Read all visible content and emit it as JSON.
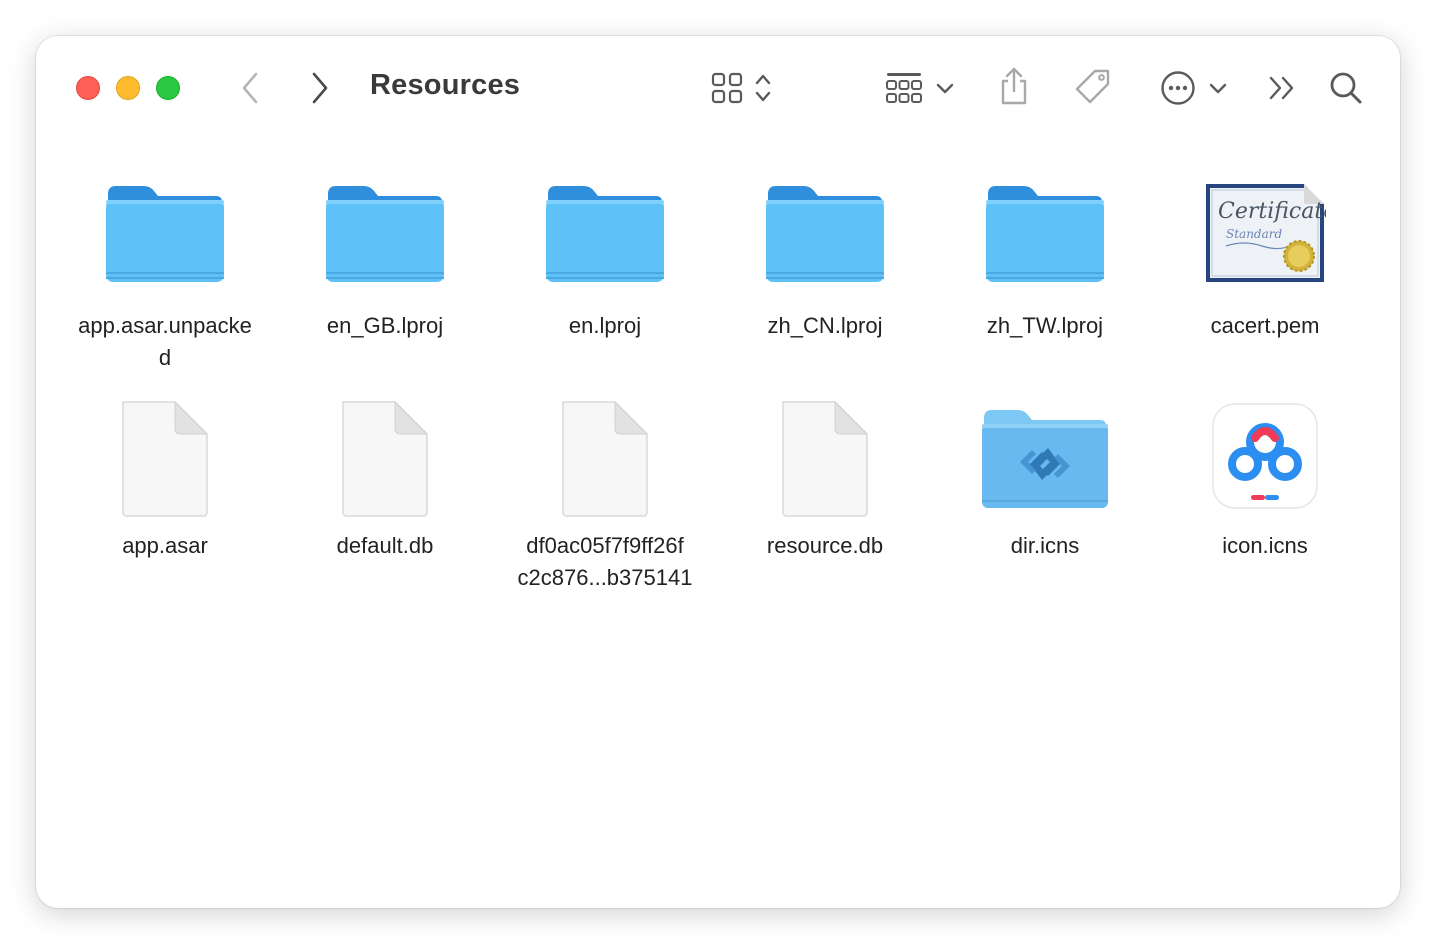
{
  "window": {
    "title": "Resources"
  },
  "toolbar": {
    "icons": [
      "back-chevron-icon",
      "forward-chevron-icon",
      "icon-view-icon",
      "sort-updown-icon",
      "group-grid-icon",
      "chevron-down-icon",
      "share-icon",
      "tag-icon",
      "more-circle-icon",
      "chevron-down-icon",
      "overflow-icon",
      "search-icon"
    ]
  },
  "files": [
    {
      "name": "app.asar.unpacke\nd",
      "label_line1": "app.asar.unpacke",
      "label_line2": "d",
      "kind": "folder"
    },
    {
      "name": "en_GB.lproj",
      "kind": "folder"
    },
    {
      "name": "en.lproj",
      "kind": "folder"
    },
    {
      "name": "zh_CN.lproj",
      "kind": "folder"
    },
    {
      "name": "zh_TW.lproj",
      "kind": "folder"
    },
    {
      "name": "cacert.pem",
      "kind": "certificate",
      "cert_text_1": "Certificate",
      "cert_text_2": "Standard"
    },
    {
      "name": "app.asar",
      "kind": "document"
    },
    {
      "name": "default.db",
      "kind": "document"
    },
    {
      "name": "df0ac05f7f9ff26f",
      "label_line1": "df0ac05f7f9ff26f",
      "label_line2": "c2c876...b375141",
      "kind": "document"
    },
    {
      "name": "resource.db",
      "kind": "document"
    },
    {
      "name": "dir.icns",
      "kind": "app-folder"
    },
    {
      "name": "icon.icns",
      "kind": "app-icon"
    }
  ],
  "colors": {
    "folder_top": "#2f8fdd",
    "folder_body": "#5ec1f8",
    "close": "#fe5f57",
    "minimize": "#febc2e",
    "zoom": "#28c840"
  }
}
